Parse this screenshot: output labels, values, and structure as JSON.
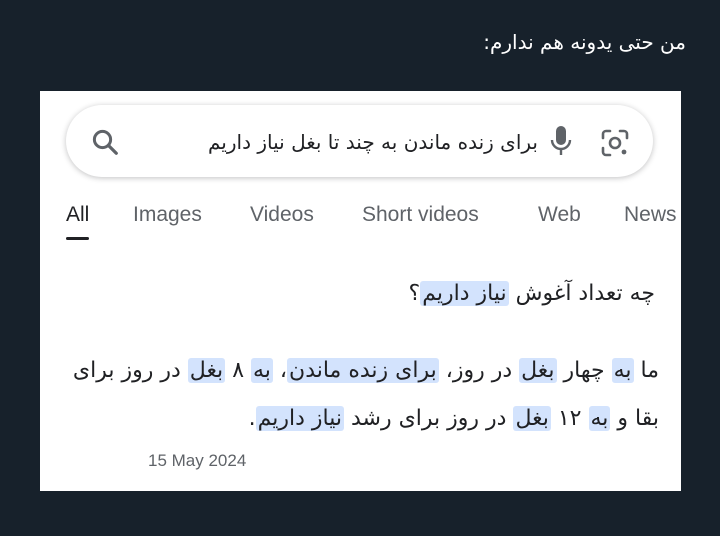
{
  "caption": "من حتی یدونه هم ندارم:",
  "search": {
    "query": "برای زنده ماندن به چند تا بغل نیاز داریم",
    "icons": [
      "search-icon",
      "mic-icon",
      "lens-icon"
    ]
  },
  "tabs": [
    {
      "label": "All",
      "active": true
    },
    {
      "label": "Images"
    },
    {
      "label": "Videos"
    },
    {
      "label": "Short videos"
    },
    {
      "label": "Web"
    },
    {
      "label": "News"
    }
  ],
  "result": {
    "question_plain": "چه تعداد آغوش ",
    "question_hl": "نیاز داریم",
    "question_end": "؟",
    "answer": {
      "p1": "ما ",
      "h1": "به",
      "p2": " چهار ",
      "h2": "بغل",
      "p3": " در روز، ",
      "h3": "برای زنده ماندن",
      "p4": "، ",
      "h4": "به",
      "p5": " ۸ ",
      "h5": "بغل",
      "p6": " در روز برای بقا و ",
      "h6": "به",
      "p7": " ۱۲ ",
      "h7": "بغل",
      "p8": " در روز برای رشد ",
      "h8": "نیاز داریم",
      "p9": "."
    },
    "date": "15 May 2024"
  },
  "colors": {
    "background": "#17212b",
    "highlight": "#d3e3fd",
    "muted_text": "#5f6368"
  }
}
